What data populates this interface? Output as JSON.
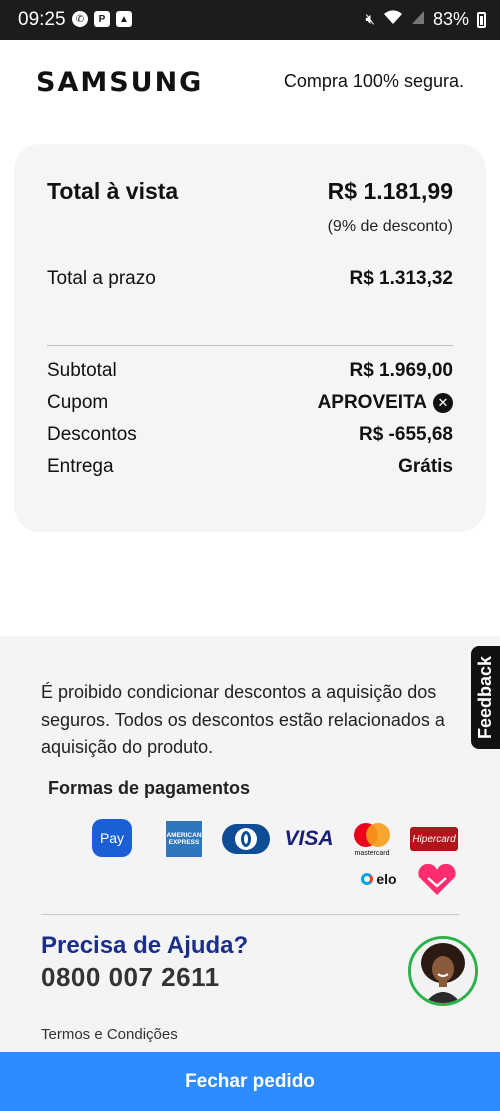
{
  "status_bar": {
    "time": "09:25",
    "battery": "83%",
    "icons": [
      "whatsapp-icon",
      "parking-icon",
      "gallery-icon",
      "mute-icon",
      "wifi-icon",
      "signal-icon",
      "battery-icon"
    ]
  },
  "header": {
    "logo": "SAMSUNG",
    "secure_text": "Compra 100% segura."
  },
  "summary": {
    "cash_label": "Total à vista",
    "cash_value": "R$ 1.181,99",
    "cash_discount_note": "(9% de desconto)",
    "installment_label": "Total a prazo",
    "installment_value": "R$ 1.313,32",
    "rows": [
      {
        "label": "Subtotal",
        "value": "R$ 1.969,00"
      },
      {
        "label": "Cupom",
        "value": "APROVEITA"
      },
      {
        "label": "Descontos",
        "value": "R$ -655,68"
      },
      {
        "label": "Entrega",
        "value": "Grátis"
      }
    ]
  },
  "footer": {
    "legal_text": "É proibido condicionar descontos a aquisição dos seguros. Todos os descontos estão relacionados a aquisição do produto.",
    "payments_title": "Formas de pagamentos",
    "payment_methods": {
      "samsung_pay": "Pay",
      "amex": "AMERICAN EXPRESS",
      "visa": "VISA",
      "mastercard": "mastercard",
      "hipercard": "Hipercard",
      "elo": "elo"
    },
    "help_title": "Precisa de Ajuda?",
    "phone": "0800 007 2611",
    "terms": "Termos e Condições"
  },
  "feedback_tab": "Feedback",
  "cta_label": "Fechar pedido",
  "colors": {
    "cta": "#2d8cff",
    "help_title": "#1a2f8a",
    "avatar_ring": "#2bb34a"
  }
}
